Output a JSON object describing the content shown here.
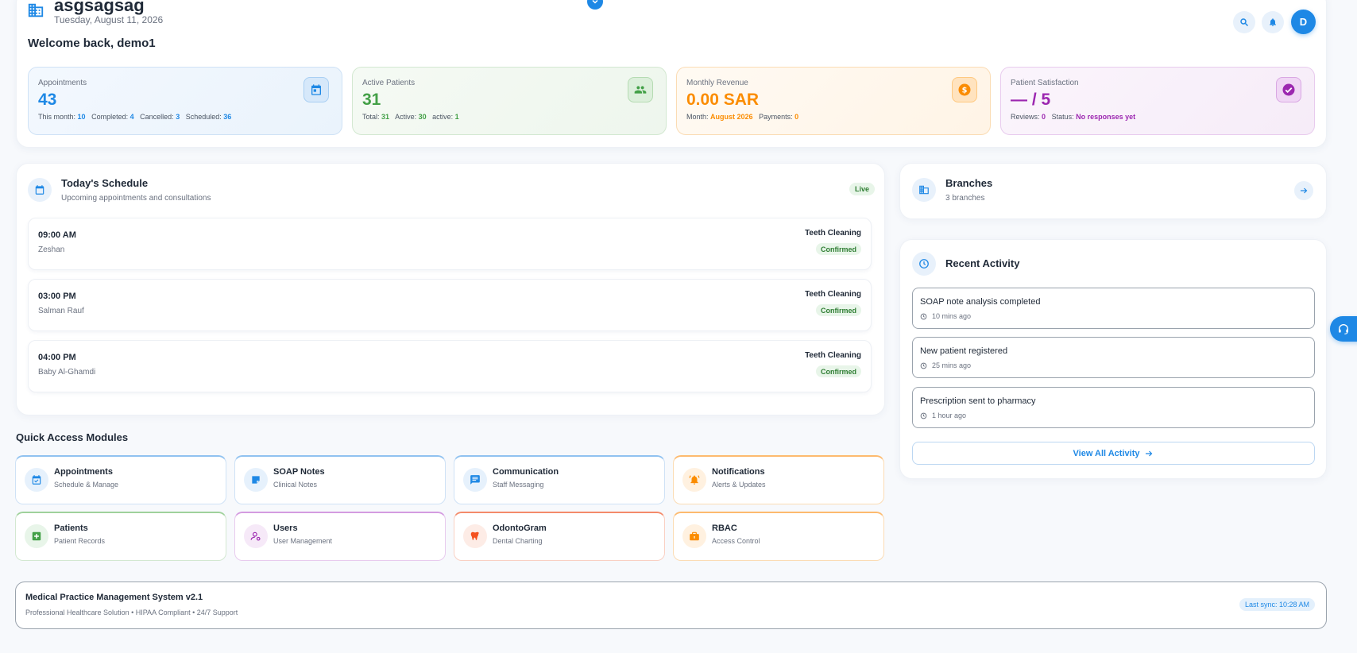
{
  "header": {
    "title": "asgsagsag",
    "date": "Tuesday, August 11, 2026",
    "welcome": "Welcome back, demo1",
    "avatar_initial": "D"
  },
  "stats": [
    {
      "label": "Appointments",
      "value": "43",
      "icon": "calendar-icon",
      "sub": [
        {
          "k": "This month:",
          "v": "10"
        },
        {
          "k": "Completed:",
          "v": "4"
        },
        {
          "k": "Cancelled:",
          "v": "3"
        },
        {
          "k": "Scheduled:",
          "v": "36"
        }
      ]
    },
    {
      "label": "Active Patients",
      "value": "31",
      "icon": "people-icon",
      "sub": [
        {
          "k": "Total:",
          "v": "31"
        },
        {
          "k": "Active:",
          "v": "30"
        },
        {
          "k": "active:",
          "v": "1"
        }
      ]
    },
    {
      "label": "Monthly Revenue",
      "value": "0.00 SAR",
      "icon": "dollar-icon",
      "sub": [
        {
          "k": "Month:",
          "v": "August 2026"
        },
        {
          "k": "Payments:",
          "v": "0"
        }
      ]
    },
    {
      "label": "Patient Satisfaction",
      "value": "— / 5",
      "icon": "check-circle-icon",
      "sub": [
        {
          "k": "Reviews:",
          "v": "0"
        },
        {
          "k": "Status:",
          "v": "No responses yet"
        }
      ]
    }
  ],
  "schedule": {
    "title": "Today's Schedule",
    "subtitle": "Upcoming appointments and consultations",
    "badge": "Live",
    "items": [
      {
        "time": "09:00 AM",
        "patient": "Zeshan",
        "service": "Teeth Cleaning",
        "status": "Confirmed"
      },
      {
        "time": "03:00 PM",
        "patient": "Salman Rauf",
        "service": "Teeth Cleaning",
        "status": "Confirmed"
      },
      {
        "time": "04:00 PM",
        "patient": "Baby Al-Ghamdi",
        "service": "Teeth Cleaning",
        "status": "Confirmed"
      }
    ]
  },
  "quick_access": {
    "title": "Quick Access Modules",
    "modules": [
      {
        "title": "Appointments",
        "subtitle": "Schedule & Manage",
        "icon": "calendar-check-icon",
        "color": "#1e88e5"
      },
      {
        "title": "SOAP Notes",
        "subtitle": "Clinical Notes",
        "icon": "note-icon",
        "color": "#1e88e5"
      },
      {
        "title": "Communication",
        "subtitle": "Staff Messaging",
        "icon": "chat-icon",
        "color": "#1e88e5"
      },
      {
        "title": "Notifications",
        "subtitle": "Alerts & Updates",
        "icon": "bell-alert-icon",
        "color": "#fb8c00"
      },
      {
        "title": "Patients",
        "subtitle": "Patient Records",
        "icon": "medical-plus-icon",
        "color": "#43a047"
      },
      {
        "title": "Users",
        "subtitle": "User Management",
        "icon": "user-settings-icon",
        "color": "#9c27b0"
      },
      {
        "title": "OdontoGram",
        "subtitle": "Dental Charting",
        "icon": "tooth-icon",
        "color": "#f4511e"
      },
      {
        "title": "RBAC",
        "subtitle": "Access Control",
        "icon": "lock-briefcase-icon",
        "color": "#fb8c00"
      }
    ]
  },
  "branches": {
    "title": "Branches",
    "subtitle": "3 branches"
  },
  "activity": {
    "title": "Recent Activity",
    "items": [
      {
        "text": "SOAP note analysis completed",
        "time": "10 mins ago"
      },
      {
        "text": "New patient registered",
        "time": "25 mins ago"
      },
      {
        "text": "Prescription sent to pharmacy",
        "time": "1 hour ago"
      }
    ],
    "view_all": "View All Activity"
  },
  "footer": {
    "title": "Medical Practice Management System v2.1",
    "subtitle": "Professional Healthcare Solution • HIPAA Compliant • 24/7 Support",
    "sync": "Last sync: 10:28 AM"
  }
}
